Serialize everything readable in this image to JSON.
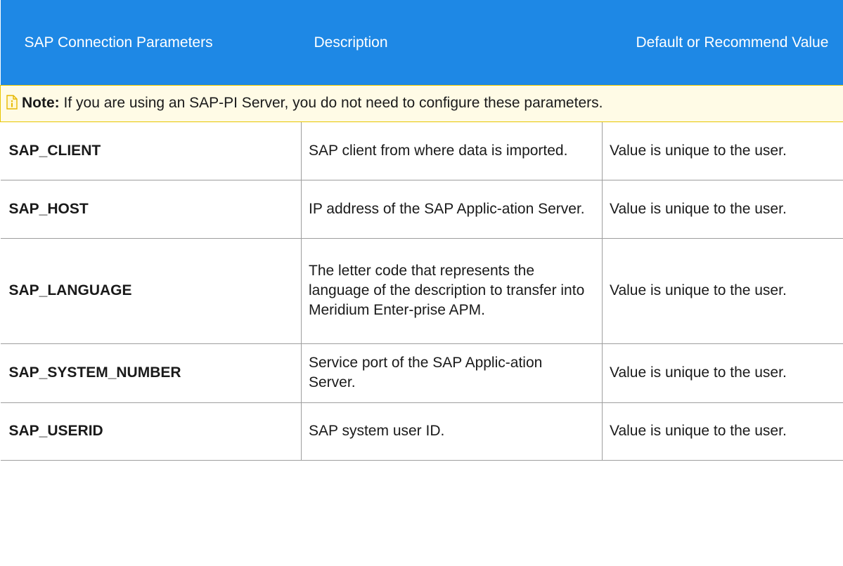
{
  "header": {
    "col1": "SAP Connection Parameters",
    "col2": "Description",
    "col3": "Default or Recommend Value"
  },
  "note": {
    "icon": "info-note-icon",
    "label": "Note:",
    "text": " If you are using an SAP-PI Server, you do not need to configure these parameters."
  },
  "rows": [
    {
      "param": "SAP_CLIENT",
      "description": "SAP client from where data is imported.",
      "value": "Value is unique to the user."
    },
    {
      "param": "SAP_HOST",
      "description": "IP address of the SAP Applic-ation Server.",
      "value": "Value is unique to the user."
    },
    {
      "param": "SAP_LANGUAGE",
      "description": "The letter code that represents the language of the description to transfer into Meridium Enter-prise APM.",
      "value": "Value is unique to the user."
    },
    {
      "param": "SAP_SYSTEM_NUMBER",
      "description": "Service port of the SAP Applic-ation Server.",
      "value": "Value is unique to the user."
    },
    {
      "param": "SAP_USERID",
      "description": "SAP system user ID.",
      "value": "Value is unique to the user."
    }
  ],
  "colors": {
    "header_bg": "#1e88e5",
    "note_bg": "#fffbe6",
    "note_border": "#e8c600"
  }
}
